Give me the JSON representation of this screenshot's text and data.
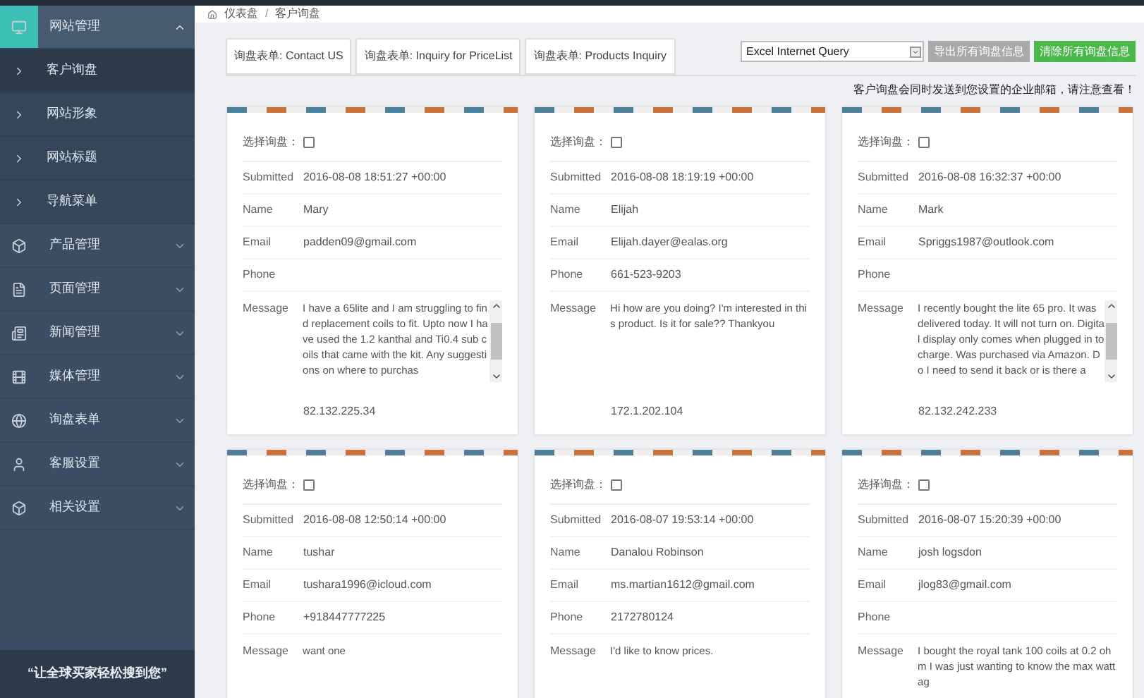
{
  "sidebar": {
    "groups": [
      {
        "label": "网站管理",
        "kind": "monitor",
        "expanded": true,
        "children": [
          {
            "label": "客户询盘",
            "selected": true
          },
          {
            "label": "网站形象",
            "selected": false
          },
          {
            "label": "网站标题",
            "selected": false
          },
          {
            "label": "导航菜单",
            "selected": false
          }
        ]
      },
      {
        "label": "产品管理",
        "kind": "products",
        "expanded": false
      },
      {
        "label": "页面管理",
        "kind": "pages",
        "expanded": false
      },
      {
        "label": "新闻管理",
        "kind": "news",
        "expanded": false
      },
      {
        "label": "媒体管理",
        "kind": "media",
        "expanded": false
      },
      {
        "label": "询盘表单",
        "kind": "forms",
        "expanded": false
      },
      {
        "label": "客服设置",
        "kind": "support",
        "expanded": false
      },
      {
        "label": "相关设置",
        "kind": "settings",
        "expanded": false
      }
    ],
    "slogan": "“让全球买家轻松搜到您”"
  },
  "breadcrumb": {
    "home": "仪表盘",
    "separator": "/",
    "current": "客户询盘"
  },
  "tabs": [
    {
      "label": "询盘表单: Contact US"
    },
    {
      "label": "询盘表单: Inquiry for PriceList"
    },
    {
      "label": "询盘表单: Products Inquiry"
    }
  ],
  "select": {
    "value": "Excel Internet Query"
  },
  "buttons": [
    {
      "label": "导出所有询盘信息",
      "kind": "secondary"
    },
    {
      "label": "清除所有询盘信息",
      "kind": "primary"
    }
  ],
  "notice": "客户询盘会同时发送到您设置的企业邮箱，请注意查看！",
  "cards": [
    {
      "select_label": "选择询盘：",
      "checked": false,
      "fields": [
        {
          "label": "Submitted",
          "value": "2016-08-08 18:51:27 +00:00"
        },
        {
          "label": "Name",
          "value": "Mary"
        },
        {
          "label": "Email",
          "value": "padden09@gmail.com"
        },
        {
          "label": "Phone"
        }
      ],
      "message_label": "Message",
      "message": "I have a 65lite and I am struggling to find replacement coils to fit. Upto now I have used the 1.2 kanthal and Ti0.4 sub coils that came with the kit. Any suggestions on where to purchas",
      "scrollable": true,
      "ip": "82.132.225.34"
    },
    {
      "select_label": "选择询盘：",
      "checked": false,
      "fields": [
        {
          "label": "Submitted",
          "value": "2016-08-08 18:19:19 +00:00"
        },
        {
          "label": "Name",
          "value": "Elijah"
        },
        {
          "label": "Email",
          "value": "Elijah.dayer@ealas.org"
        },
        {
          "label": "Phone",
          "value": "661-523-9203"
        }
      ],
      "message_label": "Message",
      "message": "Hi how are you doing? I'm interested in this product. Is it for sale?? Thankyou",
      "scrollable": false,
      "ip": "172.1.202.104"
    },
    {
      "select_label": "选择询盘：",
      "checked": false,
      "fields": [
        {
          "label": "Submitted",
          "value": "2016-08-08 16:32:37 +00:00"
        },
        {
          "label": "Name",
          "value": "Mark"
        },
        {
          "label": "Email",
          "value": "Spriggs1987@outlook.com"
        },
        {
          "label": "Phone"
        }
      ],
      "message_label": "Message",
      "message": "I recently bought the lite 65 pro. It was delivered today. It will not turn on. Digital display only comes when plugged in to charge. Was purchased via Amazon. Do I need to send it back or is there a",
      "scrollable": true,
      "ip": "82.132.242.233"
    },
    {
      "select_label": "选择询盘：",
      "checked": false,
      "fields": [
        {
          "label": "Submitted",
          "value": "2016-08-08 12:50:14 +00:00"
        },
        {
          "label": "Name",
          "value": "tushar"
        },
        {
          "label": "Email",
          "value": "tushara1996@icloud.com"
        },
        {
          "label": "Phone",
          "value": "+918447777225"
        }
      ],
      "message_label": "Message",
      "message": "want one",
      "scrollable": false
    },
    {
      "select_label": "选择询盘：",
      "checked": false,
      "fields": [
        {
          "label": "Submitted",
          "value": "2016-08-07 19:53:14 +00:00"
        },
        {
          "label": "Name",
          "value": "Danalou Robinson"
        },
        {
          "label": "Email",
          "value": "ms.martian1612@gmail.com"
        },
        {
          "label": "Phone",
          "value": "2172780124"
        }
      ],
      "message_label": "Message",
      "message": "I'd like to know prices.",
      "scrollable": false
    },
    {
      "select_label": "选择询盘：",
      "checked": false,
      "fields": [
        {
          "label": "Submitted",
          "value": "2016-08-07 15:20:39 +00:00"
        },
        {
          "label": "Name",
          "value": "josh logsdon"
        },
        {
          "label": "Email",
          "value": "jlog83@gmail.com"
        },
        {
          "label": "Phone"
        }
      ],
      "message_label": "Message",
      "message": "I bought the royal tank 100 coils at 0.2 ohm I was just wanting to know the max wattag",
      "scrollable": false
    }
  ]
}
